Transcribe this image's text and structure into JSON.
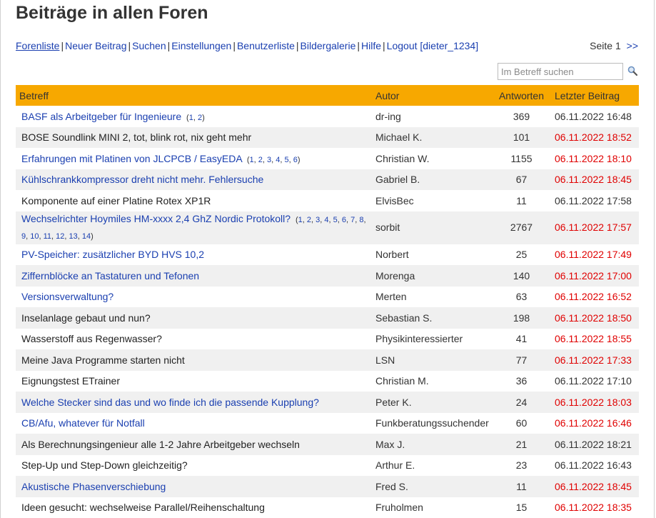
{
  "page": {
    "title": "Beiträge in allen Foren"
  },
  "nav": [
    {
      "label": "Forenliste",
      "active": true
    },
    {
      "label": "Neuer Beitrag"
    },
    {
      "label": "Suchen"
    },
    {
      "label": "Einstellungen"
    },
    {
      "label": "Benutzerliste"
    },
    {
      "label": "Bildergalerie"
    },
    {
      "label": "Hilfe"
    },
    {
      "label": "Logout [dieter_1234]"
    }
  ],
  "pager": {
    "label": "Seite 1",
    "next": ">>"
  },
  "search": {
    "placeholder": "Im Betreff suchen"
  },
  "table": {
    "headers": {
      "subject": "Betreff",
      "author": "Autor",
      "replies": "Antworten",
      "last": "Letzter Beitrag"
    },
    "rows": [
      {
        "subject": "BASF als Arbeitgeber für Ingenieure",
        "pages": [
          "1",
          "2"
        ],
        "author": "dr-ing",
        "replies": "369",
        "last": "06.11.2022 16:48",
        "unread": true,
        "new_post": false
      },
      {
        "subject": "BOSE Soundlink MINI 2, tot, blink rot, nix geht mehr",
        "pages": [],
        "author": "Michael K.",
        "replies": "101",
        "last": "06.11.2022 18:52",
        "unread": false,
        "new_post": true
      },
      {
        "subject": "Erfahrungen mit Platinen von JLCPCB / EasyEDA",
        "pages": [
          "1",
          "2",
          "3",
          "4",
          "5",
          "6"
        ],
        "author": "Christian W.",
        "replies": "1155",
        "last": "06.11.2022 18:10",
        "unread": true,
        "new_post": true
      },
      {
        "subject": "Kühlschrankkompressor dreht nicht mehr. Fehlersuche",
        "pages": [],
        "author": "Gabriel B.",
        "replies": "67",
        "last": "06.11.2022 18:45",
        "unread": true,
        "new_post": true
      },
      {
        "subject": "Komponente auf einer Platine Rotex XP1R",
        "pages": [],
        "author": "ElvisBec",
        "replies": "11",
        "last": "06.11.2022 17:58",
        "unread": false,
        "new_post": false
      },
      {
        "subject": "Wechselrichter Hoymiles HM-xxxx 2,4 GhZ Nordic Protokoll?",
        "pages": [
          "1",
          "2",
          "3",
          "4",
          "5",
          "6",
          "7",
          "8",
          "9",
          "10",
          "11",
          "12",
          "13",
          "14"
        ],
        "author": "sorbit",
        "replies": "2767",
        "last": "06.11.2022 17:57",
        "unread": true,
        "new_post": true
      },
      {
        "subject": "PV-Speicher: zusätzlicher BYD HVS 10,2",
        "pages": [],
        "author": "Norbert",
        "replies": "25",
        "last": "06.11.2022 17:49",
        "unread": true,
        "new_post": true
      },
      {
        "subject": "Ziffernblöcke an Tastaturen und Tefonen",
        "pages": [],
        "author": "Morenga",
        "replies": "140",
        "last": "06.11.2022 17:00",
        "unread": true,
        "new_post": true
      },
      {
        "subject": "Versionsverwaltung?",
        "pages": [],
        "author": "Merten",
        "replies": "63",
        "last": "06.11.2022 16:52",
        "unread": true,
        "new_post": true
      },
      {
        "subject": "Inselanlage gebaut und nun?",
        "pages": [],
        "author": "Sebastian S.",
        "replies": "198",
        "last": "06.11.2022 18:50",
        "unread": false,
        "new_post": true
      },
      {
        "subject": "Wasserstoff aus Regenwasser?",
        "pages": [],
        "author": "Physikinteressierter",
        "replies": "41",
        "last": "06.11.2022 18:55",
        "unread": false,
        "new_post": true
      },
      {
        "subject": "Meine Java Programme starten nicht",
        "pages": [],
        "author": "LSN",
        "replies": "77",
        "last": "06.11.2022 17:33",
        "unread": false,
        "new_post": true
      },
      {
        "subject": "Eignungstest ETrainer",
        "pages": [],
        "author": "Christian M.",
        "replies": "36",
        "last": "06.11.2022 17:10",
        "unread": false,
        "new_post": false
      },
      {
        "subject": "Welche Stecker sind das und wo finde ich die passende Kupplung?",
        "pages": [],
        "author": "Peter K.",
        "replies": "24",
        "last": "06.11.2022 18:03",
        "unread": true,
        "new_post": true
      },
      {
        "subject": "CB/Afu, whatever für Notfall",
        "pages": [],
        "author": "Funkberatungssuchender",
        "replies": "60",
        "last": "06.11.2022 16:46",
        "unread": true,
        "new_post": true
      },
      {
        "subject": "Als Berechnungsingenieur alle 1-2 Jahre Arbeitgeber wechseln",
        "pages": [],
        "author": "Max J.",
        "replies": "21",
        "last": "06.11.2022 18:21",
        "unread": false,
        "new_post": false
      },
      {
        "subject": "Step-Up und Step-Down gleichzeitig?",
        "pages": [],
        "author": "Arthur E.",
        "replies": "23",
        "last": "06.11.2022 16:43",
        "unread": false,
        "new_post": false
      },
      {
        "subject": "Akustische Phasenverschiebung",
        "pages": [],
        "author": "Fred S.",
        "replies": "11",
        "last": "06.11.2022 18:45",
        "unread": true,
        "new_post": true
      },
      {
        "subject": "Ideen gesucht: wechselweise Parallel/Reihenschaltung",
        "pages": [],
        "author": "Fruholmen",
        "replies": "15",
        "last": "06.11.2022 18:35",
        "unread": false,
        "new_post": true
      }
    ]
  },
  "colors": {
    "header_bg": "#f7a800",
    "link": "#1a3fb0",
    "new_post": "#e00000",
    "alt_row": "#f0f0f0"
  }
}
